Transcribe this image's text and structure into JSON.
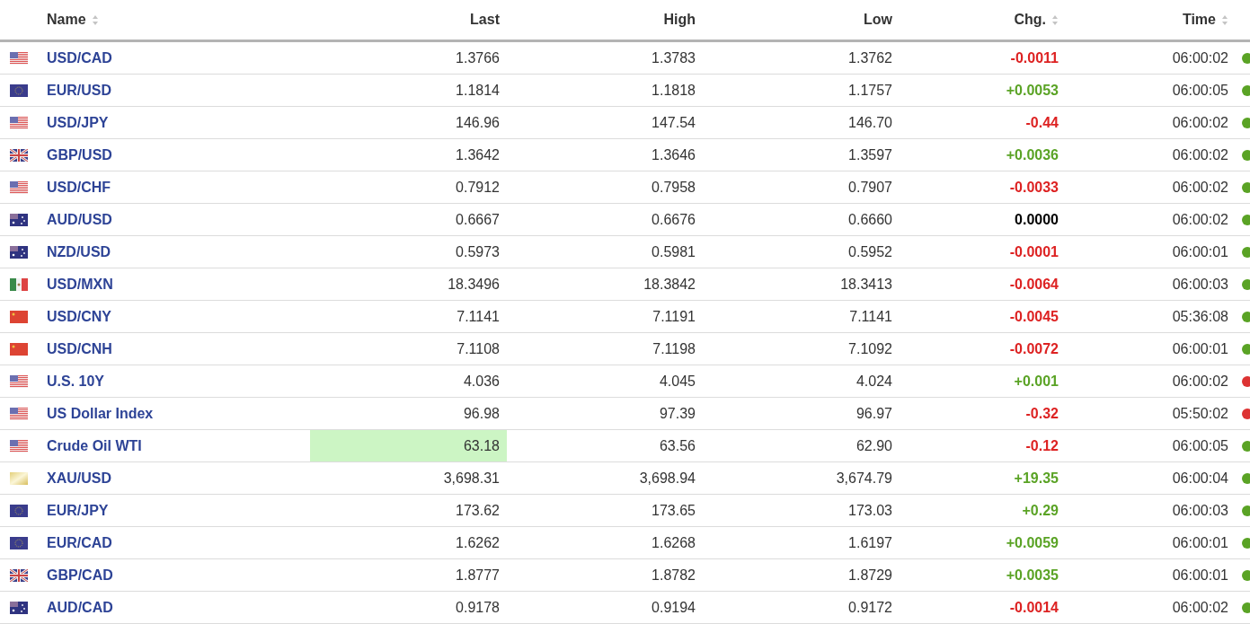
{
  "table": {
    "columns": [
      {
        "label": "Name",
        "sortable": true
      },
      {
        "label": "Last",
        "sortable": false
      },
      {
        "label": "High",
        "sortable": false
      },
      {
        "label": "Low",
        "sortable": false
      },
      {
        "label": "Chg.",
        "sortable": true
      },
      {
        "label": "Time",
        "sortable": true
      }
    ],
    "rows": [
      {
        "flag": {
          "kind": "us"
        },
        "name": "USD/CAD",
        "last": "1.3766",
        "high": "1.3783",
        "low": "1.3762",
        "change": {
          "value": "-0.0011",
          "color": "#dd2222"
        },
        "time": "06:00:02",
        "status": {
          "color": "#5aa325"
        },
        "highlighted": false
      },
      {
        "flag": {
          "kind": "eu"
        },
        "name": "EUR/USD",
        "last": "1.1814",
        "high": "1.1818",
        "low": "1.1757",
        "change": {
          "value": "+0.0053",
          "color": "#5aa325"
        },
        "time": "06:00:05",
        "status": {
          "color": "#5aa325"
        },
        "highlighted": false
      },
      {
        "flag": {
          "kind": "us"
        },
        "name": "USD/JPY",
        "last": "146.96",
        "high": "147.54",
        "low": "146.70",
        "change": {
          "value": "-0.44",
          "color": "#dd2222"
        },
        "time": "06:00:02",
        "status": {
          "color": "#5aa325"
        },
        "highlighted": false
      },
      {
        "flag": {
          "kind": "gb"
        },
        "name": "GBP/USD",
        "last": "1.3642",
        "high": "1.3646",
        "low": "1.3597",
        "change": {
          "value": "+0.0036",
          "color": "#5aa325"
        },
        "time": "06:00:02",
        "status": {
          "color": "#5aa325"
        },
        "highlighted": false
      },
      {
        "flag": {
          "kind": "us"
        },
        "name": "USD/CHF",
        "last": "0.7912",
        "high": "0.7958",
        "low": "0.7907",
        "change": {
          "value": "-0.0033",
          "color": "#dd2222"
        },
        "time": "06:00:02",
        "status": {
          "color": "#5aa325"
        },
        "highlighted": false
      },
      {
        "flag": {
          "kind": "au"
        },
        "name": "AUD/USD",
        "last": "0.6667",
        "high": "0.6676",
        "low": "0.6660",
        "change": {
          "value": "0.0000",
          "color": "#000000"
        },
        "time": "06:00:02",
        "status": {
          "color": "#5aa325"
        },
        "highlighted": false
      },
      {
        "flag": {
          "kind": "au"
        },
        "name": "NZD/USD",
        "last": "0.5973",
        "high": "0.5981",
        "low": "0.5952",
        "change": {
          "value": "-0.0001",
          "color": "#dd2222"
        },
        "time": "06:00:01",
        "status": {
          "color": "#5aa325"
        },
        "highlighted": false
      },
      {
        "flag": {
          "kind": "mx"
        },
        "name": "USD/MXN",
        "last": "18.3496",
        "high": "18.3842",
        "low": "18.3413",
        "change": {
          "value": "-0.0064",
          "color": "#dd2222"
        },
        "time": "06:00:03",
        "status": {
          "color": "#5aa325"
        },
        "highlighted": false
      },
      {
        "flag": {
          "kind": "cn"
        },
        "name": "USD/CNY",
        "last": "7.1141",
        "high": "7.1191",
        "low": "7.1141",
        "change": {
          "value": "-0.0045",
          "color": "#dd2222"
        },
        "time": "05:36:08",
        "status": {
          "color": "#5aa325"
        },
        "highlighted": false
      },
      {
        "flag": {
          "kind": "cn"
        },
        "name": "USD/CNH",
        "last": "7.1108",
        "high": "7.1198",
        "low": "7.1092",
        "change": {
          "value": "-0.0072",
          "color": "#dd2222"
        },
        "time": "06:00:01",
        "status": {
          "color": "#5aa325"
        },
        "highlighted": false
      },
      {
        "flag": {
          "kind": "us"
        },
        "name": "U.S. 10Y",
        "last": "4.036",
        "high": "4.045",
        "low": "4.024",
        "change": {
          "value": "+0.001",
          "color": "#5aa325"
        },
        "time": "06:00:02",
        "status": {
          "color": "#dd3333"
        },
        "highlighted": false
      },
      {
        "flag": {
          "kind": "us"
        },
        "name": "US Dollar Index",
        "last": "96.98",
        "high": "97.39",
        "low": "96.97",
        "change": {
          "value": "-0.32",
          "color": "#dd2222"
        },
        "time": "05:50:02",
        "status": {
          "color": "#dd3333"
        },
        "highlighted": false
      },
      {
        "flag": {
          "kind": "us"
        },
        "name": "Crude Oil WTI",
        "last": "63.18",
        "high": "63.56",
        "low": "62.90",
        "change": {
          "value": "-0.12",
          "color": "#dd2222"
        },
        "time": "06:00:05",
        "status": {
          "color": "#5aa325"
        },
        "highlighted": true
      },
      {
        "flag": {
          "kind": "gold"
        },
        "name": "XAU/USD",
        "last": "3,698.31",
        "high": "3,698.94",
        "low": "3,674.79",
        "change": {
          "value": "+19.35",
          "color": "#5aa325"
        },
        "time": "06:00:04",
        "status": {
          "color": "#5aa325"
        },
        "highlighted": false
      },
      {
        "flag": {
          "kind": "eu"
        },
        "name": "EUR/JPY",
        "last": "173.62",
        "high": "173.65",
        "low": "173.03",
        "change": {
          "value": "+0.29",
          "color": "#5aa325"
        },
        "time": "06:00:03",
        "status": {
          "color": "#5aa325"
        },
        "highlighted": false
      },
      {
        "flag": {
          "kind": "eu"
        },
        "name": "EUR/CAD",
        "last": "1.6262",
        "high": "1.6268",
        "low": "1.6197",
        "change": {
          "value": "+0.0059",
          "color": "#5aa325"
        },
        "time": "06:00:01",
        "status": {
          "color": "#5aa325"
        },
        "highlighted": false
      },
      {
        "flag": {
          "kind": "gb"
        },
        "name": "GBP/CAD",
        "last": "1.8777",
        "high": "1.8782",
        "low": "1.8729",
        "change": {
          "value": "+0.0035",
          "color": "#5aa325"
        },
        "time": "06:00:01",
        "status": {
          "color": "#5aa325"
        },
        "highlighted": false
      },
      {
        "flag": {
          "kind": "au"
        },
        "name": "AUD/CAD",
        "last": "0.9178",
        "high": "0.9194",
        "low": "0.9172",
        "change": {
          "value": "-0.0014",
          "color": "#dd2222"
        },
        "time": "06:00:02",
        "status": {
          "color": "#5aa325"
        },
        "highlighted": false
      }
    ]
  }
}
